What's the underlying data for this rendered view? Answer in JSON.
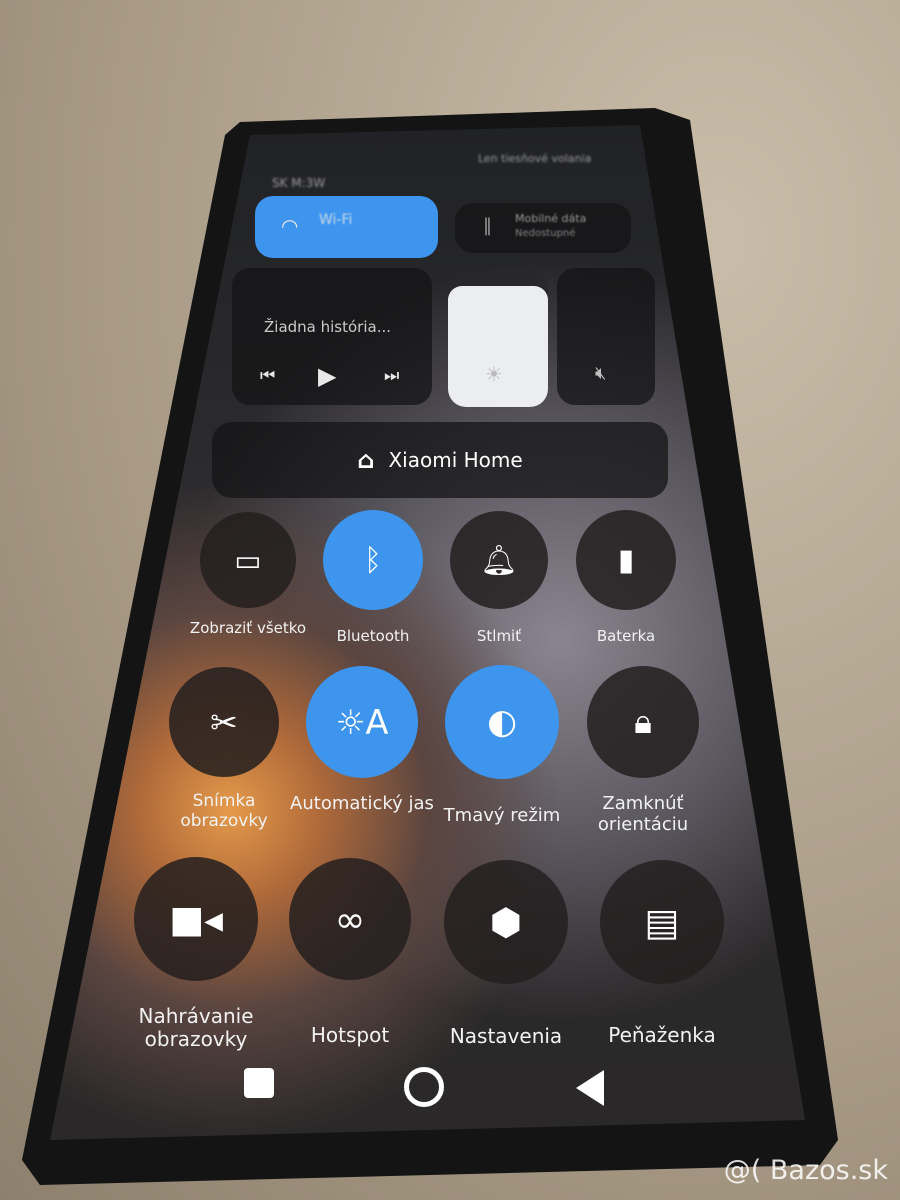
{
  "status": {
    "carrier": "SK M:3W",
    "right_text": "Len tiesňové volania"
  },
  "wifi": {
    "label": "Wi-Fi",
    "color": "#3d95ee"
  },
  "mobile_data": {
    "label": "Mobilné dáta",
    "sub": "Nedostupné"
  },
  "media": {
    "title": "Žiadna história...",
    "icons": [
      "previous-icon",
      "play-icon",
      "next-icon"
    ]
  },
  "brightness": {
    "level": 0.88
  },
  "volume": {
    "state": "muted"
  },
  "xiaomi_home": {
    "label": "Xiaomi Home"
  },
  "toggles": [
    {
      "label": "Zobraziť všetko",
      "icon": "card-icon",
      "on": false
    },
    {
      "label": "Bluetooth",
      "icon": "bluetooth-icon",
      "on": true
    },
    {
      "label": "Stlmiť",
      "icon": "bell-icon",
      "on": false
    },
    {
      "label": "Baterka",
      "icon": "flashlight-icon",
      "on": false
    },
    {
      "label": "Snímka obrazovky",
      "icon": "screenshot-icon",
      "on": false
    },
    {
      "label": "Automatický jas",
      "icon": "auto-brightness-icon",
      "on": true
    },
    {
      "label": "Tmavý režim",
      "icon": "dark-mode-icon",
      "on": true
    },
    {
      "label": "Zamknúť orientáciu",
      "icon": "rotation-lock-icon",
      "on": false
    },
    {
      "label": "Nahrávanie obrazovky",
      "icon": "video-camera-icon",
      "on": false
    },
    {
      "label": "Hotspot",
      "icon": "link-icon",
      "on": false
    },
    {
      "label": "Nastavenia",
      "icon": "settings-icon",
      "on": false
    },
    {
      "label": "Peňaženka",
      "icon": "wallet-icon",
      "on": false
    }
  ],
  "nav": [
    "recents-button",
    "home-button",
    "back-button"
  ],
  "watermark": "@( Bazos.sk"
}
